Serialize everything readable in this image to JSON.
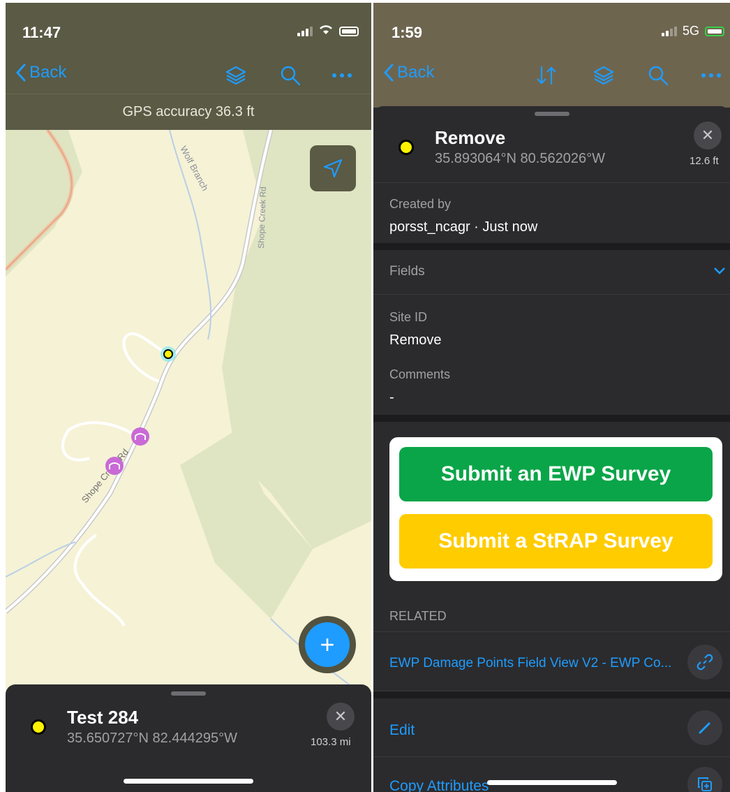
{
  "left": {
    "status": {
      "time": "11:47"
    },
    "nav": {
      "back_label": "Back"
    },
    "gps_text": "GPS accuracy 36.3 ft",
    "map_labels": {
      "wolf_branch": "Wolf Branch",
      "shope_creek_rd_top": "Shope Creek Rd",
      "shope_creek_rd_bottom": "Shope Creek Rd"
    },
    "feature": {
      "title": "Test 284",
      "coords": "35.650727°N  82.444295°W",
      "distance": "103.3 mi"
    },
    "fab_label": "+"
  },
  "right": {
    "status": {
      "time": "1:59",
      "network": "5G"
    },
    "nav": {
      "back_label": "Back"
    },
    "feature": {
      "title": "Remove",
      "coords": "35.893064°N  80.562026°W",
      "distance": "12.6 ft"
    },
    "created_by": {
      "label": "Created by",
      "value": "porsst_ncagr · Just now"
    },
    "fields": {
      "label": "Fields"
    },
    "site_id": {
      "label": "Site ID",
      "value": "Remove"
    },
    "comments": {
      "label": "Comments",
      "value": "-"
    },
    "surveys": {
      "ewp": "Submit an EWP Survey",
      "strap": "Submit a StRAP Survey"
    },
    "related": {
      "label": "RELATED",
      "link": "EWP Damage Points Field View V2 - EWP Co..."
    },
    "actions": {
      "edit": "Edit",
      "copy": "Copy Attributes"
    }
  },
  "colors": {
    "accent": "#1e9cff",
    "sheet": "#2b2b2d",
    "ewp_green": "#0aa548",
    "strap_yellow": "#ffcc00",
    "point_yellow": "#fff200",
    "pink_marker": "#c96ad6"
  }
}
